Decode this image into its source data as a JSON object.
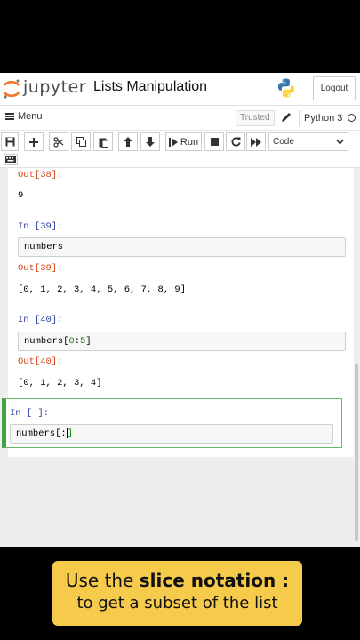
{
  "header": {
    "logo_text": "jupyter",
    "notebook_title": "Lists Manipulation",
    "logout_label": "Logout"
  },
  "menubar": {
    "menu_label": "Menu",
    "trusted_label": "Trusted",
    "kernel_name": "Python 3"
  },
  "toolbar": {
    "run_label": "Run",
    "cell_type": "Code",
    "icons": [
      "save-icon",
      "plus-icon",
      "scissors-icon",
      "copy-icon",
      "paste-icon",
      "arrow-up-icon",
      "arrow-down-icon",
      "run-icon",
      "stop-icon",
      "restart-icon",
      "fast-forward-icon",
      "keyboard-icon"
    ]
  },
  "cells": {
    "out38_prompt": "Out[38]:",
    "out38_value": "9",
    "in39_prompt": "In [39]:",
    "in39_code": "numbers",
    "out39_prompt": "Out[39]:",
    "out39_value": "[0, 1, 2, 3, 4, 5, 6, 7, 8, 9]",
    "in40_prompt": "In [40]:",
    "in40_code_name": "numbers",
    "in40_code_open": "[",
    "in40_code_start": "0",
    "in40_code_colon": ":",
    "in40_code_end": "5",
    "in40_code_close": "]",
    "out40_prompt": "Out[40]:",
    "out40_value": "[0, 1, 2, 3, 4]",
    "in_new_prompt": "In [ ]:",
    "in_new_code_name": "numbers",
    "in_new_code_open": "[",
    "in_new_code_colon": ":",
    "in_new_code_close": "]"
  },
  "caption": {
    "line1_plain": "Use the ",
    "line1_bold": "slice notation :",
    "line2": "to get a subset of the list"
  },
  "colors": {
    "in_prompt": "#303f9f",
    "out_prompt": "#d84315",
    "selected_cell_border": "#43a047",
    "caption_bg": "#f6ca4a"
  }
}
